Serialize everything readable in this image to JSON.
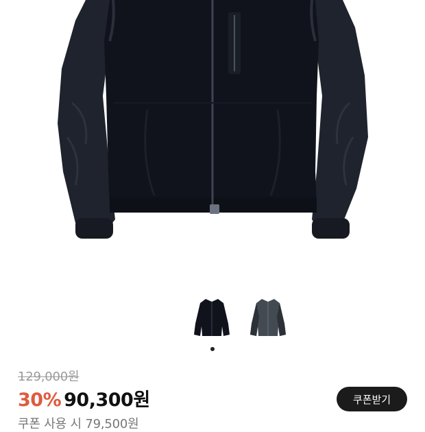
{
  "product": {
    "image": {
      "icon": "black-fleece-zip-jacket"
    },
    "thumbnails": [
      {
        "icon": "black-jacket-thumbnail"
      },
      {
        "icon": "gray-jacket-thumbnail"
      }
    ],
    "gallery_page": {
      "current": 1,
      "total": 1
    }
  },
  "pricing": {
    "original_price": "129,000원",
    "discount_rate": "30%",
    "sale_price": "90,300원",
    "coupon_button_label": "쿠폰받기",
    "coupon_price_note": "쿠폰 사용 시 79,500원"
  },
  "colors": {
    "discount": "#e05a3f",
    "button_bg": "#1b1b1b",
    "jacket_body": "#10131c",
    "jacket_sleeve": "#1f232d",
    "gray_jacket": "#444a52"
  }
}
